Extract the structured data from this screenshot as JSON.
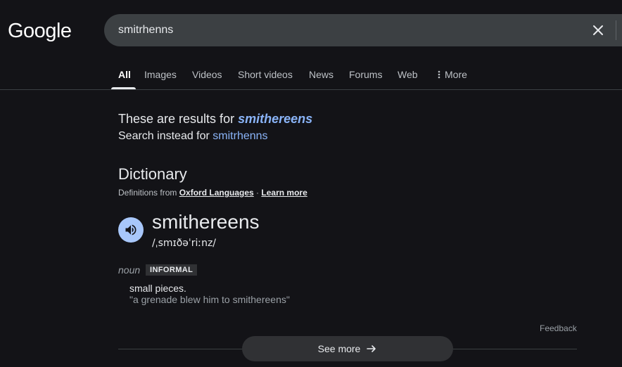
{
  "header": {
    "logo": "Google",
    "search_value": "smitrhenns",
    "clear_icon": "close-icon"
  },
  "tabs": [
    {
      "label": "All",
      "active": true
    },
    {
      "label": "Images"
    },
    {
      "label": "Videos"
    },
    {
      "label": "Short videos"
    },
    {
      "label": "News"
    },
    {
      "label": "Forums"
    },
    {
      "label": "Web"
    },
    {
      "label": "More",
      "icon": "more-vert-icon"
    }
  ],
  "correction": {
    "prefix": "These are results for ",
    "corrected": "smithereens",
    "instead_prefix": "Search instead for ",
    "original": "smitrhenns"
  },
  "dictionary": {
    "title": "Dictionary",
    "source_prefix": "Definitions from ",
    "source_name": "Oxford Languages",
    "separator": " · ",
    "learn_more": "Learn more",
    "audio_icon": "volume-icon",
    "word": "smithereens",
    "phonetic": "/ˌsmɪðəˈriːnz/",
    "part_of_speech": "noun",
    "register_label": "INFORMAL",
    "definition": "small pieces.",
    "example": "\"a grenade blew him to smithereens\"",
    "feedback": "Feedback",
    "see_more": "See more",
    "see_more_icon": "arrow-right-icon"
  },
  "colors": {
    "background": "#131317",
    "link": "#8ab4f8",
    "audio_button": "#a8c7fa"
  }
}
